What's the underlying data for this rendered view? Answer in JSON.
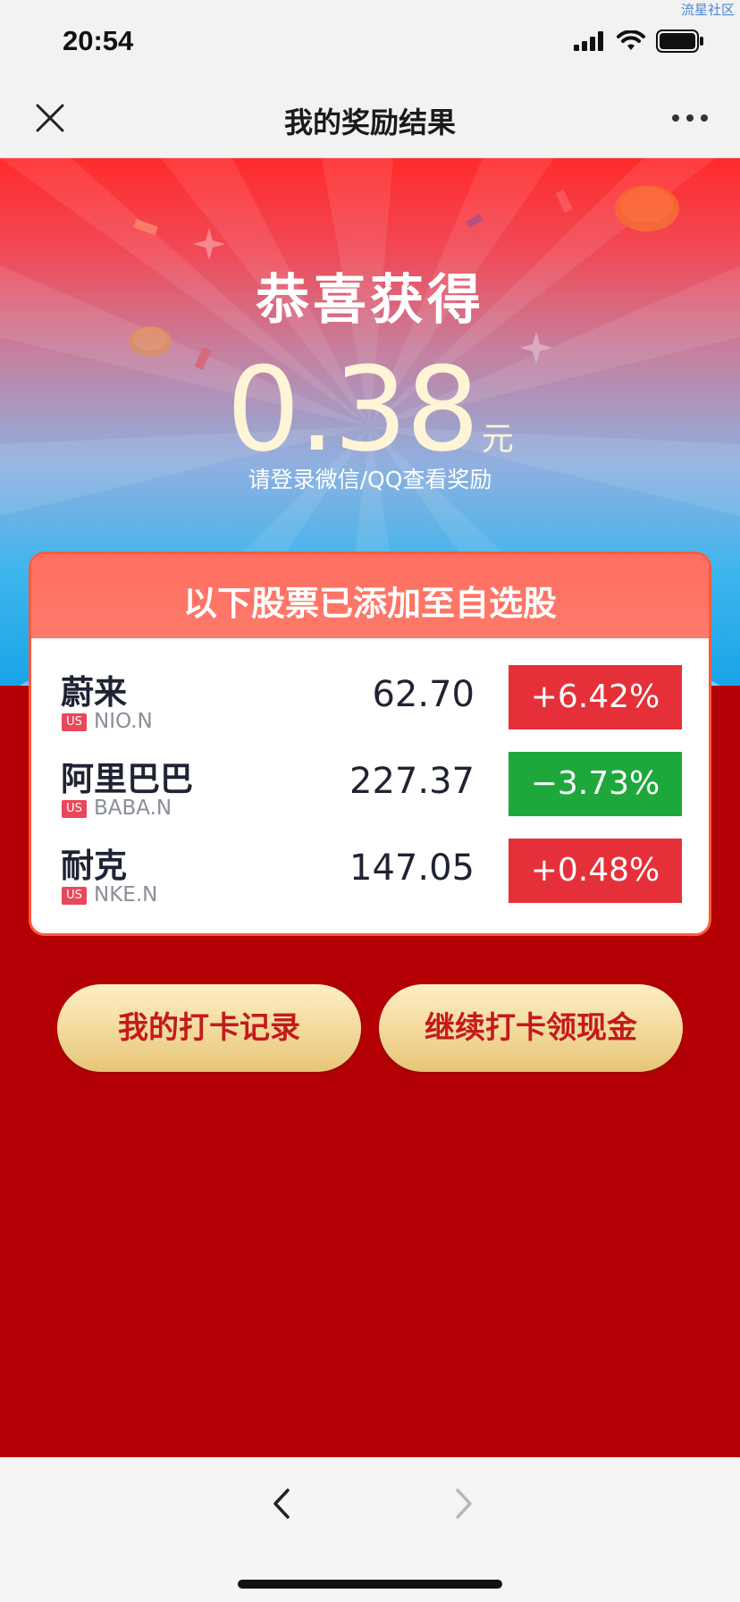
{
  "watermark": "流星社区",
  "status_bar": {
    "time": "20:54"
  },
  "nav": {
    "title": "我的奖励结果"
  },
  "hero": {
    "congrats": "恭喜获得",
    "amount": "0.38",
    "unit": "元",
    "hint": "请登录微信/QQ查看奖励"
  },
  "stocks_card": {
    "title": "以下股票已添加至自选股",
    "rows": [
      {
        "name": "蔚来",
        "market": "US",
        "ticker": "NIO.N",
        "price": "62.70",
        "change": "+6.42%",
        "direction": "up"
      },
      {
        "name": "阿里巴巴",
        "market": "US",
        "ticker": "BABA.N",
        "price": "227.37",
        "change": "−3.73%",
        "direction": "down"
      },
      {
        "name": "耐克",
        "market": "US",
        "ticker": "NKE.N",
        "price": "147.05",
        "change": "+0.48%",
        "direction": "up"
      }
    ]
  },
  "buttons": {
    "checkin_record": "我的打卡记录",
    "continue_checkin": "继续打卡领现金"
  },
  "colors": {
    "background_red": "#b20005",
    "up_red": "#e5303a",
    "down_green": "#1ea83c",
    "button_gold": "#f1d796",
    "button_text": "#c41a1c"
  }
}
